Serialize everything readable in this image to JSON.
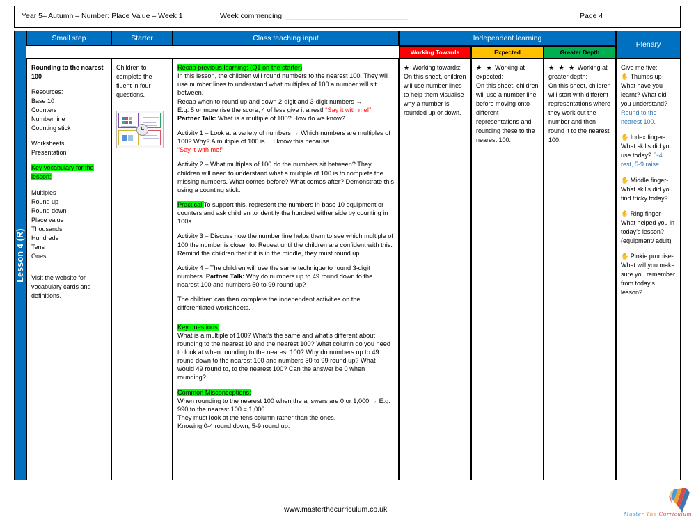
{
  "header": {
    "title": "Year 5– Autumn – Number: Place Value – Week 1",
    "week_commencing": "Week commencing: ______________________________",
    "page": "Page 4"
  },
  "lesson_tab": {
    "label": "Lesson 4 (R)",
    "color": "#0070C0"
  },
  "columns": {
    "small_step": "Small step",
    "starter": "Starter",
    "class_teaching_input": "Class teaching input",
    "independent_learning": "Independent learning",
    "plenary": "Plenary"
  },
  "differentiation": {
    "working_towards": {
      "label": "Working Towards",
      "color": "#FF0000"
    },
    "expected": {
      "label": "Expected",
      "color": "#FFC000"
    },
    "greater_depth": {
      "label": "Greater Depth",
      "color": "#00B050"
    }
  },
  "small_step": {
    "title": "Rounding to the nearest 100",
    "resources_heading": "Resources:",
    "resources": [
      "Base 10",
      "Counters",
      "Number line",
      "Counting stick"
    ],
    "resources_extra": [
      "Worksheets",
      "Presentation"
    ],
    "vocab_heading": "Key vocabulary for the lesson:",
    "vocabulary": [
      "Multiples",
      "Round up",
      "Round down",
      "Place value",
      "Thousands",
      "Hundreds",
      "Tens",
      "Ones"
    ],
    "footer_note": "Visit the website for vocabulary cards and definitions."
  },
  "starter": {
    "text": "Children to complete the fluent in four questions.",
    "thumbnail_alt": "fluent-in-four-worksheet-thumbnail"
  },
  "teaching": {
    "recap_heading": "Recap previous learning: (Q1 on the starter)",
    "recap_body": "In this lesson, the children will round numbers to the nearest 100. They will use number lines to understand what multiples of 100 a number will sit between.",
    "recap_line2": "Recap when to round up and down 2-digit and 3-digit numbers →",
    "recap_line3a": "E.g. 5 or more rise the score, 4 of less give it a rest! ",
    "recap_line3b": "“Say it with me!”",
    "partner_talk_label": "Partner Talk:",
    "partner_talk_text": " What is a multiple of 100? How do we know?",
    "activity1": "Activity 1 – Look at a variety of numbers → Which numbers are multiples of 100? Why? A multiple of 100 is… I know this because…",
    "activity1_red": "“Say it with me!”",
    "activity2": "Activity 2 – What multiples of 100 do the numbers sit between? They children will need to understand what a multiple of 100 is to complete the missing numbers. What comes before? What comes after? Demonstrate this using a counting stick.",
    "practical_label": "Practical:",
    "practical_text": "To support this, represent the numbers in base 10 equipment or counters and ask children to identify the hundred either side by counting in 100s.",
    "activity3": "Activity 3 – Discuss how the number line helps them to see which multiple of 100 the number is closer to. Repeat until the children are confident with this. Remind the children that if it is in the middle, they must round up.",
    "activity4_pre": "Activity 4 – The children will use the same technique to round 3-digit numbers. ",
    "activity4_bold": "Partner Talk:",
    "activity4_post": " Why do numbers up to 49 round down to the nearest 100  and numbers 50 to 99 round up?",
    "worksheets_note": "The children can then complete the independent activities on the differentiated worksheets.",
    "key_questions_heading": "Key questions:",
    "key_questions_body": "What is a multiple of 100? What’s the same and what’s different about rounding to the nearest 10 and the nearest 100? What column do you need to look at when rounding to the nearest 100? Why do numbers up to 49 round down to the nearest 100 and numbers 50 to 99 round up? What would 49 round to, to the nearest 100? Can the answer be 0 when rounding?",
    "misconceptions_heading": "Common Misconceptions:",
    "misconceptions_line1": "When rounding to the nearest 100 when the answers are 0 or 1,000 → E.g. 990 to the nearest 100 = 1,000.",
    "misconceptions_line2": "They must look at the tens column rather than the ones.",
    "misconceptions_line3": "Knowing 0-4 round down, 5-9 round up."
  },
  "independent": {
    "working_towards": {
      "stars": "★",
      "star_count": 1,
      "heading": "Working towards:",
      "body": "On this sheet, children will use number lines to help them visualise why a number is rounded up or down."
    },
    "expected": {
      "stars": "★ ★",
      "star_count": 2,
      "heading": "Working at expected:",
      "body": "On this sheet, children will use a number line before moving onto different representations and rounding these to the nearest 100."
    },
    "greater_depth": {
      "stars": "★ ★ ★",
      "star_count": 3,
      "heading": "Working at greater depth:",
      "body": "On this sheet, children will start with different representations where they work out the number and then round it to the nearest 100."
    }
  },
  "plenary": {
    "intro": "Give me five:",
    "items": [
      {
        "icon": "hand-icon",
        "text": "Thumbs up- What have you learnt? What did you understand?",
        "answer": "Round to the nearest 100."
      },
      {
        "icon": "hand-icon",
        "text": "Index finger- What skills did you use today?",
        "answer": "0-4 rest, 5-9 raise."
      },
      {
        "icon": "hand-icon",
        "text": "Middle finger- What skills did you find tricky today?",
        "answer": ""
      },
      {
        "icon": "hand-icon",
        "text": "Ring finger- What helped you in today’s lesson? (equipment/ adult)",
        "answer": ""
      },
      {
        "icon": "hand-icon",
        "text": "Pinkie promise- What will you make sure you remember from today’s lesson?",
        "answer": ""
      }
    ]
  },
  "footer": {
    "url": "www.masterthecurriculum.co.uk",
    "logo_word1": "Master",
    "logo_word2": "The",
    "logo_word3": "Curriculum"
  }
}
